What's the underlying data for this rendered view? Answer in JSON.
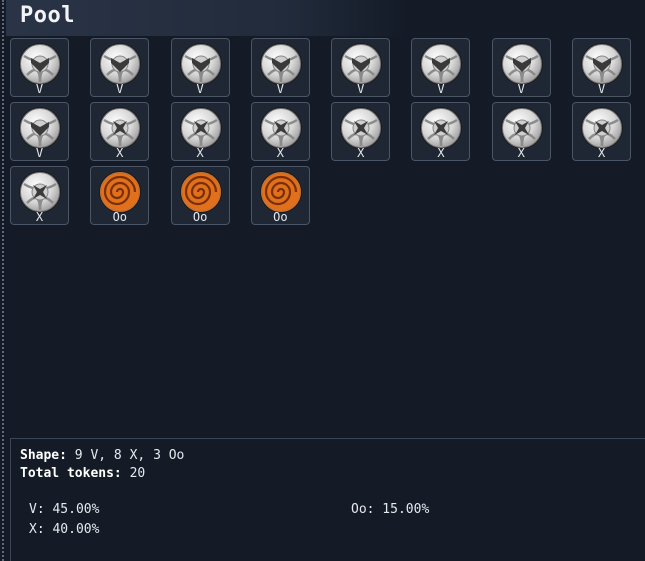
{
  "header": {
    "title": "Pool"
  },
  "tokens": [
    {
      "type": "V",
      "label": "V"
    },
    {
      "type": "V",
      "label": "V"
    },
    {
      "type": "V",
      "label": "V"
    },
    {
      "type": "V",
      "label": "V"
    },
    {
      "type": "V",
      "label": "V"
    },
    {
      "type": "V",
      "label": "V"
    },
    {
      "type": "V",
      "label": "V"
    },
    {
      "type": "V",
      "label": "V"
    },
    {
      "type": "V",
      "label": "V"
    },
    {
      "type": "X",
      "label": "X"
    },
    {
      "type": "X",
      "label": "X"
    },
    {
      "type": "X",
      "label": "X"
    },
    {
      "type": "X",
      "label": "X"
    },
    {
      "type": "X",
      "label": "X"
    },
    {
      "type": "X",
      "label": "X"
    },
    {
      "type": "X",
      "label": "X"
    },
    {
      "type": "X",
      "label": "X"
    },
    {
      "type": "Oo",
      "label": "Oo"
    },
    {
      "type": "Oo",
      "label": "Oo"
    },
    {
      "type": "Oo",
      "label": "Oo"
    }
  ],
  "summary": {
    "shape_label": "Shape:",
    "shape_value": "9 V, 8 X, 3 Oo",
    "total_label": "Total tokens:",
    "total_value": "20"
  },
  "percentages": {
    "v": "V: 45.00%",
    "x": "X: 40.00%",
    "oo": "Oo: 15.00%"
  },
  "colors": {
    "background": "#141b27",
    "token_border": "#4a5566",
    "silver": "#d9d9d9",
    "orange": "#e0701c"
  }
}
